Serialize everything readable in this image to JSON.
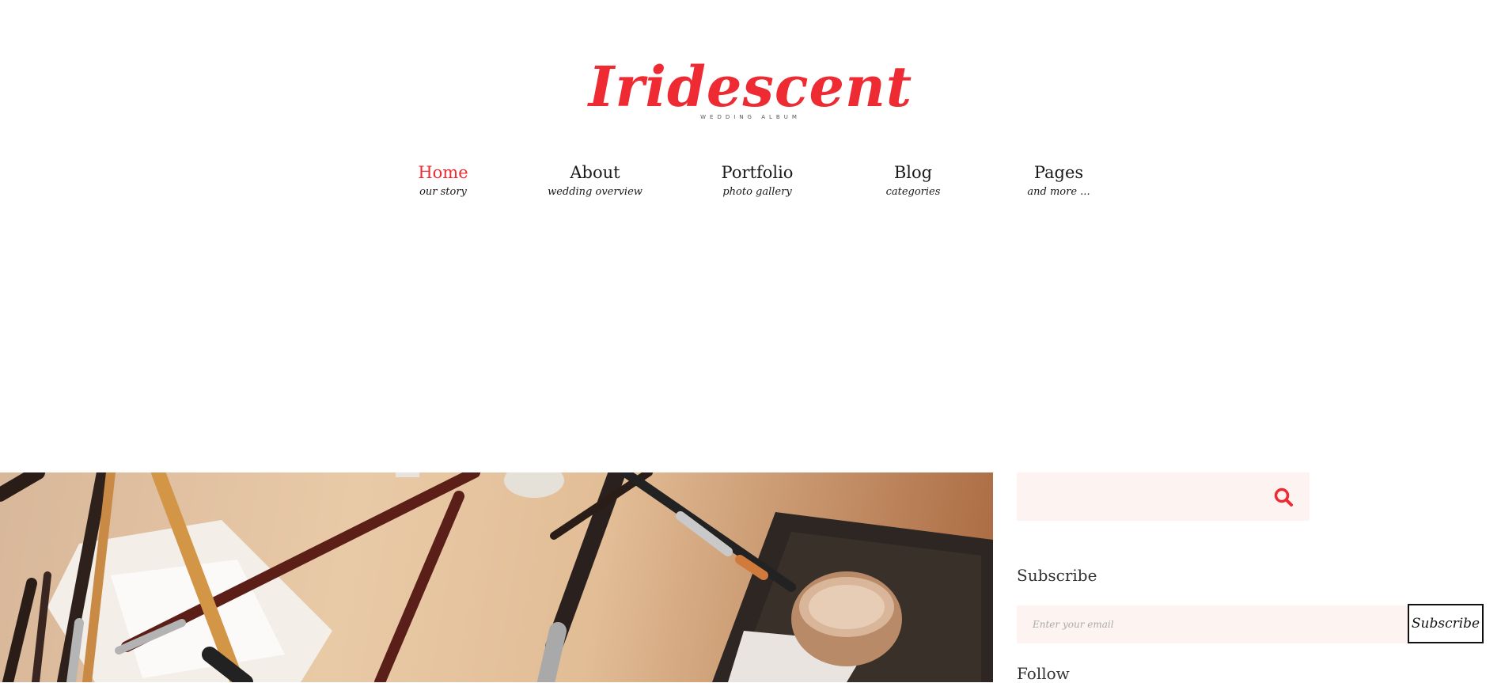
{
  "site": {
    "logo_text": "Iridescent",
    "logo_tagline": "WEDDING ALBUM",
    "brand_color": "#ee2a33"
  },
  "nav": {
    "items": [
      {
        "label": "Home",
        "sub": "our story",
        "active": true
      },
      {
        "label": "About",
        "sub": "wedding overview",
        "active": false
      },
      {
        "label": "Portfolio",
        "sub": "photo gallery",
        "active": false
      },
      {
        "label": "Blog",
        "sub": "categories",
        "active": false
      },
      {
        "label": "Pages",
        "sub": "and more ...",
        "active": false
      }
    ]
  },
  "hero": {
    "image": "makeup-brushes-photo"
  },
  "sidebar": {
    "search": {
      "value": "",
      "icon": "search-icon"
    },
    "subscribe": {
      "title": "Subscribe",
      "placeholder": "Enter your email",
      "button_label": "Subscribe"
    },
    "follow": {
      "title": "Follow"
    }
  }
}
